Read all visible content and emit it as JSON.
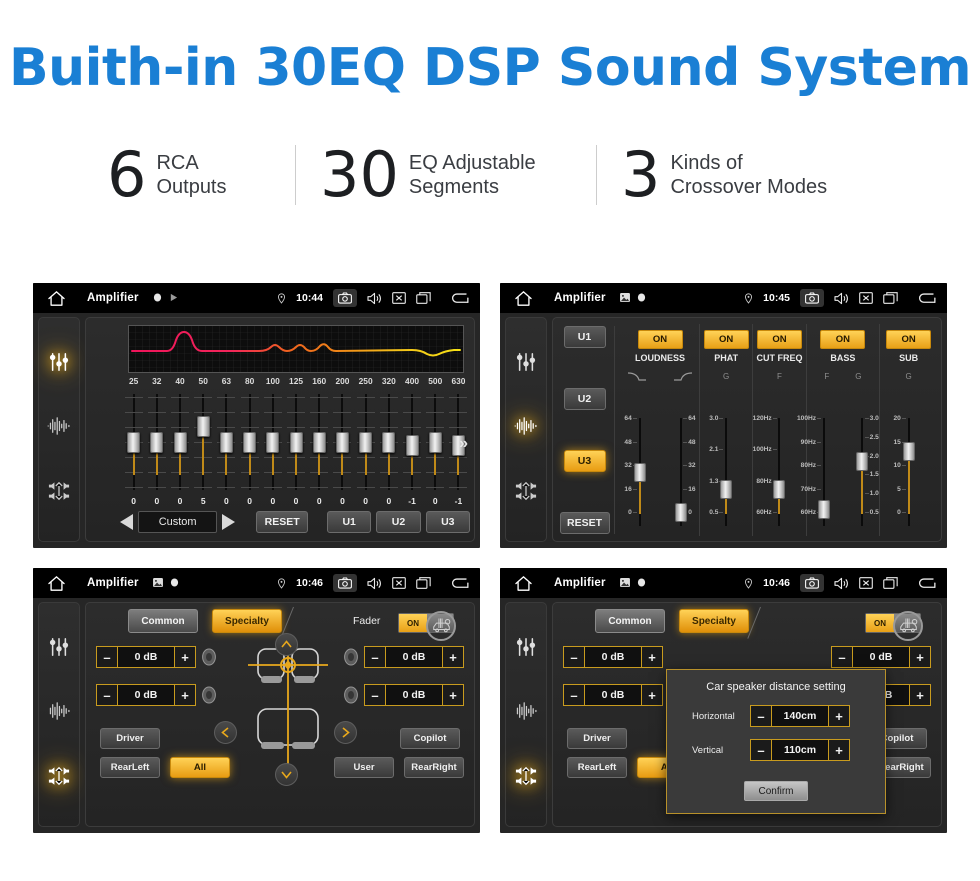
{
  "hero": {
    "title": "Buith-in 30EQ DSP Sound System",
    "accent_color": "#1a7fd4"
  },
  "stats": [
    {
      "number": "6",
      "line1": "RCA",
      "line2": "Outputs"
    },
    {
      "number": "30",
      "line1": "EQ Adjustable",
      "line2": "Segments"
    },
    {
      "number": "3",
      "line1": "Kinds of",
      "line2": "Crossover Modes"
    }
  ],
  "panels": {
    "eq": {
      "statusbar": {
        "title": "Amplifier",
        "time": "10:44",
        "icons": [
          "home-icon",
          "record-dot-icon",
          "play-icon",
          "location-pin-icon",
          "camera-icon",
          "volume-icon",
          "close-icon",
          "recent-apps-icon",
          "back-icon"
        ]
      },
      "sidebar": [
        {
          "icon": "equalizer-icon",
          "active": true
        },
        {
          "icon": "waveform-icon",
          "active": false
        },
        {
          "icon": "balance-icon",
          "active": false
        }
      ],
      "frequencies": [
        "25",
        "32",
        "40",
        "50",
        "63",
        "80",
        "100",
        "125",
        "160",
        "200",
        "250",
        "320",
        "400",
        "500",
        "630"
      ],
      "values": [
        "0",
        "0",
        "0",
        "5",
        "0",
        "0",
        "0",
        "0",
        "0",
        "0",
        "0",
        "0",
        "-1",
        "0",
        "-1"
      ],
      "preset": "Custom",
      "prev_label": "◀",
      "next_label": "▶",
      "more_label": "»",
      "reset_label": "RESET",
      "user_presets": [
        "U1",
        "U2",
        "U3"
      ]
    },
    "amp": {
      "statusbar": {
        "title": "Amplifier",
        "time": "10:45"
      },
      "sidebar": [
        {
          "icon": "equalizer-icon",
          "active": false
        },
        {
          "icon": "waveform-icon",
          "active": true
        },
        {
          "icon": "balance-icon",
          "active": false
        }
      ],
      "user_buttons": [
        "U1",
        "U2",
        "U3"
      ],
      "active_user": "U3",
      "reset_label": "RESET",
      "groups": [
        {
          "name": "LOUDNESS",
          "state": "ON",
          "sub": [
            "curve-down-icon",
            "curve-up-icon"
          ],
          "sliders": [
            {
              "label": "",
              "scale": [
                "64",
                "48",
                "32",
                "16",
                "0"
              ],
              "pos": 50
            },
            {
              "label": "",
              "scale": [
                "64",
                "48",
                "32",
                "16",
                "0"
              ],
              "pos": 5
            }
          ]
        },
        {
          "name": "PHAT",
          "state": "ON",
          "sub": [
            "G"
          ],
          "sliders": [
            {
              "label": "G",
              "scale": [
                "3.0",
                "2.1",
                "1.3",
                "0.5"
              ],
              "pos": 30
            }
          ]
        },
        {
          "name": "CUT FREQ",
          "state": "ON",
          "sub": [
            "F"
          ],
          "sliders": [
            {
              "label": "F",
              "scale": [
                "120Hz",
                "100Hz",
                "80Hz",
                "60Hz"
              ],
              "pos": 30
            }
          ]
        },
        {
          "name": "BASS",
          "state": "ON",
          "sub": [
            "F",
            "G"
          ],
          "sliders": [
            {
              "label": "F",
              "scale": [
                "100Hz",
                "90Hz",
                "80Hz",
                "70Hz",
                "60Hz"
              ],
              "pos": 8
            },
            {
              "label": "G",
              "scale": [
                "3.0",
                "2.5",
                "2.0",
                "1.5",
                "1.0",
                "0.5"
              ],
              "pos": 62
            }
          ]
        },
        {
          "name": "SUB",
          "state": "ON",
          "sub": [
            "G"
          ],
          "sliders": [
            {
              "label": "G",
              "scale": [
                "20",
                "15",
                "10",
                "5",
                "0"
              ],
              "pos": 73
            }
          ]
        }
      ]
    },
    "fader": {
      "statusbar": {
        "title": "Amplifier",
        "time": "10:46"
      },
      "sidebar": [
        {
          "icon": "equalizer-icon",
          "active": false
        },
        {
          "icon": "waveform-icon",
          "active": false
        },
        {
          "icon": "balance-icon",
          "active": true
        }
      ],
      "tabs": [
        {
          "label": "Common",
          "active": false
        },
        {
          "label": "Specialty",
          "active": true
        }
      ],
      "fader_label": "Fader",
      "fader_state": "ON",
      "car_config_icon": "car-settings-icon",
      "steppers": [
        {
          "position": "front-left",
          "value": "0 dB",
          "minus": "–",
          "plus": "+"
        },
        {
          "position": "front-right",
          "value": "0 dB",
          "minus": "–",
          "plus": "+"
        },
        {
          "position": "rear-left",
          "value": "0 dB",
          "minus": "–",
          "plus": "+"
        },
        {
          "position": "rear-right",
          "value": "0 dB",
          "minus": "–",
          "plus": "+"
        }
      ],
      "seat_buttons": [
        {
          "label": "Driver",
          "active": false
        },
        {
          "label": "Copilot",
          "active": false
        },
        {
          "label": "RearLeft",
          "active": false
        },
        {
          "label": "All",
          "active": true
        },
        {
          "label": "User",
          "active": false
        },
        {
          "label": "RearRight",
          "active": false
        }
      ]
    },
    "dialog_panel": {
      "statusbar": {
        "title": "Amplifier",
        "time": "10:46"
      },
      "dialog": {
        "title": "Car speaker distance setting",
        "rows": [
          {
            "label": "Horizontal",
            "value": "140cm",
            "minus": "–",
            "plus": "+"
          },
          {
            "label": "Vertical",
            "value": "110cm",
            "minus": "–",
            "plus": "+"
          }
        ],
        "confirm_label": "Confirm"
      }
    }
  },
  "colors": {
    "gold": "#e8a017",
    "panel_bg": "#262626",
    "statusbar_bg": "#000000"
  }
}
